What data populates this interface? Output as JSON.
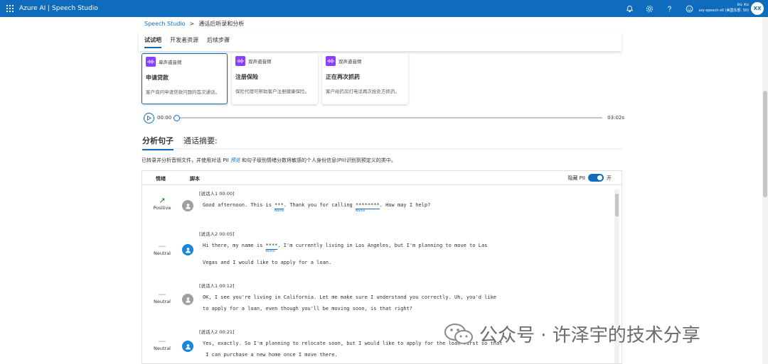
{
  "header": {
    "brand": "Azure AI  |  Speech Studio",
    "user_name": "xu xu",
    "user_sub": "szy-speech-s0 (美国东部, S0)",
    "avatar_initials": "XX"
  },
  "breadcrumb": {
    "root": "Speech Studio",
    "separator": ">",
    "current": "通话后听录和分析"
  },
  "tabs": [
    {
      "label": "试试吧"
    },
    {
      "label": "开发者资源"
    },
    {
      "label": "后续步骤"
    }
  ],
  "cards": [
    {
      "type": "单声道音频",
      "title": "申请贷款",
      "desc": "客户询问申请贷款问题的首次通话。"
    },
    {
      "type": "双声道音频",
      "title": "注册保险",
      "desc": "保险代理可帮助客户注册健康保险。"
    },
    {
      "type": "双声道音频",
      "title": "正在再次抓药",
      "desc": "客户给药房打电话再次抢处方抓药。"
    }
  ],
  "player": {
    "current": "00:00",
    "duration": "03:02s",
    "progress": 0
  },
  "analysis_tabs": [
    {
      "label": "分析句子"
    },
    {
      "label": "通话摘要:"
    }
  ],
  "intro": {
    "part1": "已转录并分析音频文件，并使用对话 PII",
    "link": "预览",
    "part2": "和句子级别情绪分数将敏感的个人身份信息(PII)识别到预定义的类中。"
  },
  "table": {
    "col_sentiment": "情绪",
    "col_script": "脚本",
    "pii_label": "隐藏 PII",
    "pii_state": "开"
  },
  "rows": [
    {
      "sentiment": "Positive",
      "meta": "[说话人1 00:00]",
      "l1a": "Good afternoon. This is ",
      "m1": "***",
      "l1b": ". Thank you for calling ",
      "m2": "********",
      "l1c": ". How may I help?",
      "tag1": "Name",
      "tag2": "Name"
    },
    {
      "sentiment": "Neutral",
      "meta": "[说话人2 00:05]",
      "l1a": "Hi there, my name is ",
      "m1": "****",
      "l1b": ". I'm currently living in Los Angeles, but I'm planning to move to Las",
      "l2": "Vegas and I would like to apply for a loan.",
      "tag1": "Name"
    },
    {
      "sentiment": "Neutral",
      "meta": "[说话人1 00:12]",
      "l1": "OK, I see you're living in California. Let me make sure I understand you correctly. Uh, you'd like",
      "l2": "to apply for a loan, even though you'll be moving soon, is that right?"
    },
    {
      "sentiment": "Neutral",
      "meta": "[说话人2 00:21]",
      "l1": "Yes, exactly. So I'm planning to relocate soon, but I would like to apply for the loan first so that",
      "l2": " I can purchase a new home once I move there."
    }
  ],
  "watermark": {
    "text": "公众号 · 许泽宇的技术分享"
  }
}
